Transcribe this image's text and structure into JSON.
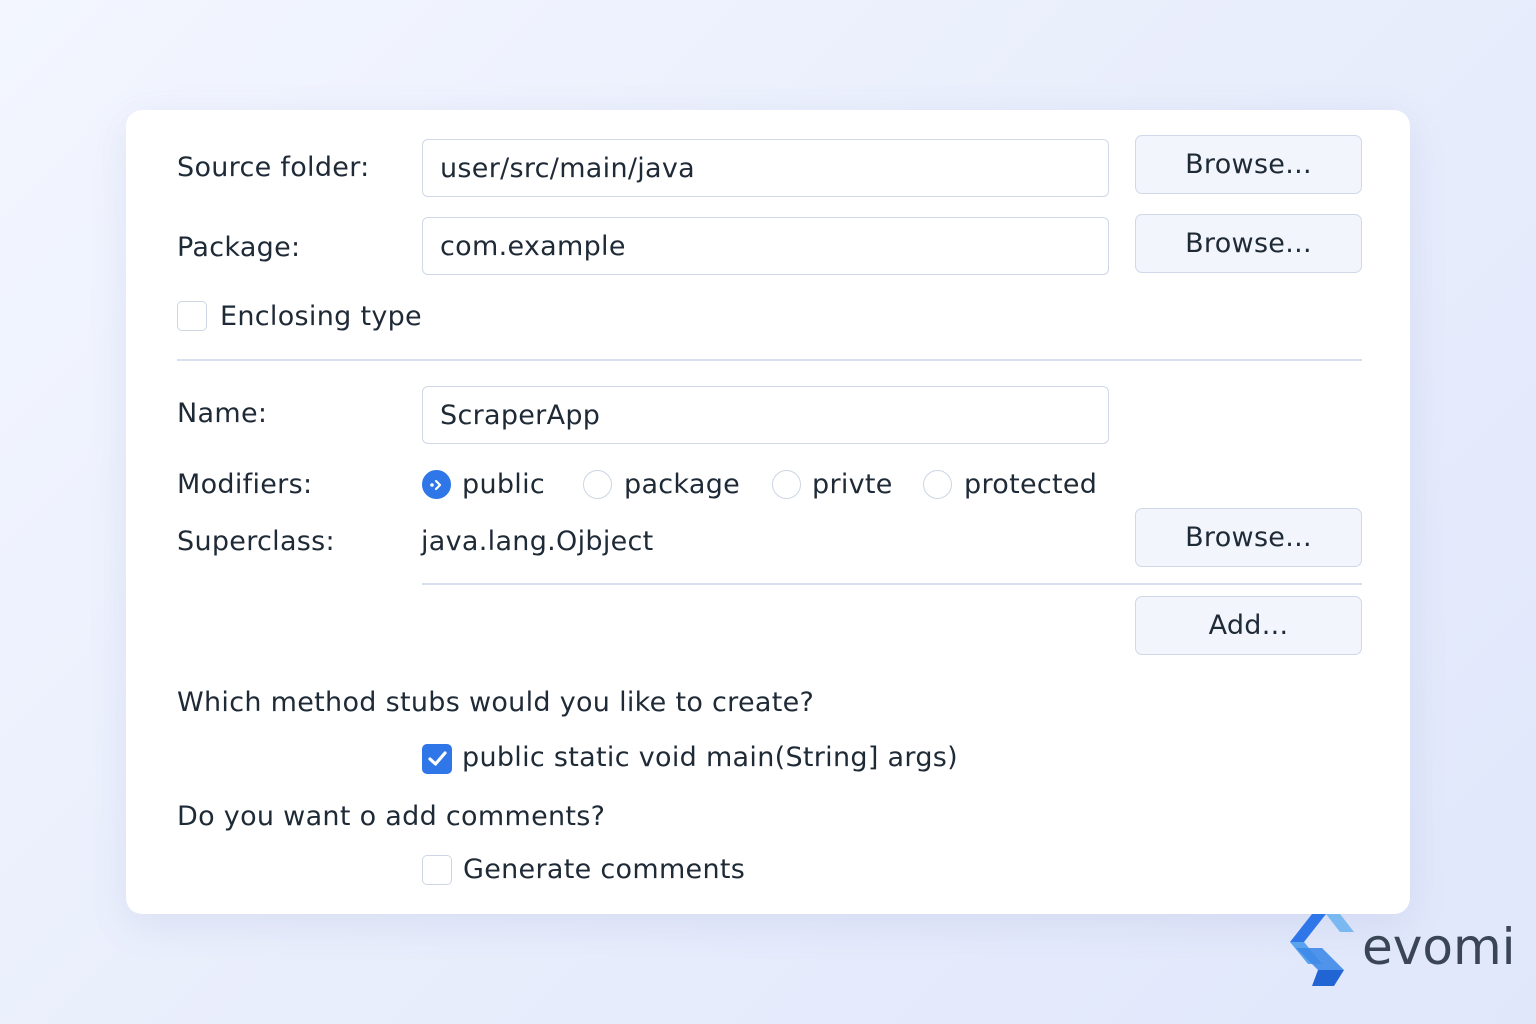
{
  "source_folder": {
    "label": "Source folder:",
    "value": "user/src/main/java",
    "browse": "Browse..."
  },
  "package": {
    "label": "Package:",
    "value": "com.example",
    "browse": "Browse..."
  },
  "enclosing_type": {
    "label": "Enclosing type",
    "checked": false
  },
  "name": {
    "label": "Name:",
    "value": "ScraperApp"
  },
  "modifiers": {
    "label": "Modifiers:",
    "options": [
      "public",
      "package",
      "privte",
      "protected"
    ],
    "selected": "public"
  },
  "superclass": {
    "label": "Superclass:",
    "value": "java.lang.Ojbject",
    "browse": "Browse..."
  },
  "interfaces": {
    "add": "Add..."
  },
  "method_stubs": {
    "question": "Which method stubs would you like to create?",
    "main_option": "public static void main(String] args)",
    "main_checked": true
  },
  "comments": {
    "question": "Do you want o add comments?",
    "option": "Generate comments",
    "checked": false
  },
  "brand": {
    "name": "evomi"
  },
  "colors": {
    "accent": "#2f76e8",
    "background": "#eaf0fd",
    "border": "#cfd8e6"
  }
}
